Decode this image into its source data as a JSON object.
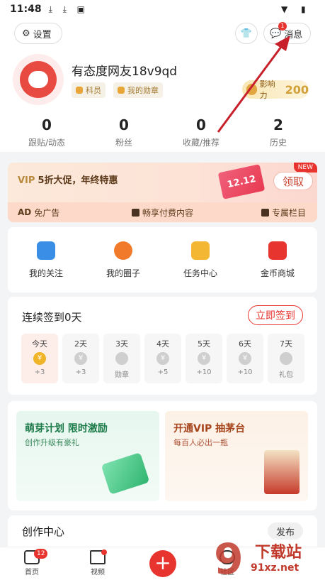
{
  "status_bar": {
    "time": "11:48"
  },
  "header": {
    "settings_label": "设置",
    "messages_label": "消息",
    "messages_badge": "1",
    "username": "有态度网友18v9qd",
    "tags": [
      "科员",
      "我的勋章"
    ],
    "influence_label": "影响力",
    "influence_value": "200"
  },
  "stats": [
    {
      "num": "0",
      "label": "跟贴/动态"
    },
    {
      "num": "0",
      "label": "粉丝"
    },
    {
      "num": "0",
      "label": "收藏/推荐"
    },
    {
      "num": "2",
      "label": "历史"
    }
  ],
  "vip": {
    "title_vip": "VIP",
    "title_rest": "5折大促，年终特惠",
    "new_badge": "NEW",
    "gift_label": "12.12",
    "claim_label": "领取",
    "perks": [
      "免广告",
      "畅享付费内容",
      "专属栏目"
    ],
    "perk_ad_prefix": "AD"
  },
  "quick_links": [
    {
      "label": "我的关注",
      "color": "#3a8ee6"
    },
    {
      "label": "我的圈子",
      "color": "#f07a2a"
    },
    {
      "label": "任务中心",
      "color": "#f4b733"
    },
    {
      "label": "金币商城",
      "color": "#e8342e"
    }
  ],
  "checkin": {
    "title": "连续签到0天",
    "sign_label": "立即签到",
    "coin_symbol": "¥",
    "days": [
      {
        "day": "今天",
        "reward": "+3"
      },
      {
        "day": "2天",
        "reward": "+3"
      },
      {
        "day": "3天",
        "reward": "勋章"
      },
      {
        "day": "4天",
        "reward": "+5"
      },
      {
        "day": "5天",
        "reward": "+10"
      },
      {
        "day": "6天",
        "reward": "+10"
      },
      {
        "day": "7天",
        "reward": "礼包"
      }
    ]
  },
  "promos": {
    "left": {
      "title": "萌芽计划 限时激励",
      "subtitle": "创作升级有豪礼"
    },
    "right": {
      "title": "开通VIP 抽茅台",
      "subtitle": "每百人必出一瓶"
    }
  },
  "creator": {
    "title": "创作中心",
    "publish_label": "发布"
  },
  "tabbar": {
    "home_label": "首页",
    "home_badge": "12",
    "video_label": "视频",
    "plus_label": "+",
    "community_label": "社区"
  },
  "watermark": {
    "text": "下载站",
    "sub": "91xz.net",
    "logo": "9"
  },
  "colors": {
    "accent": "#e8342e",
    "arrow": "#c8202b"
  }
}
